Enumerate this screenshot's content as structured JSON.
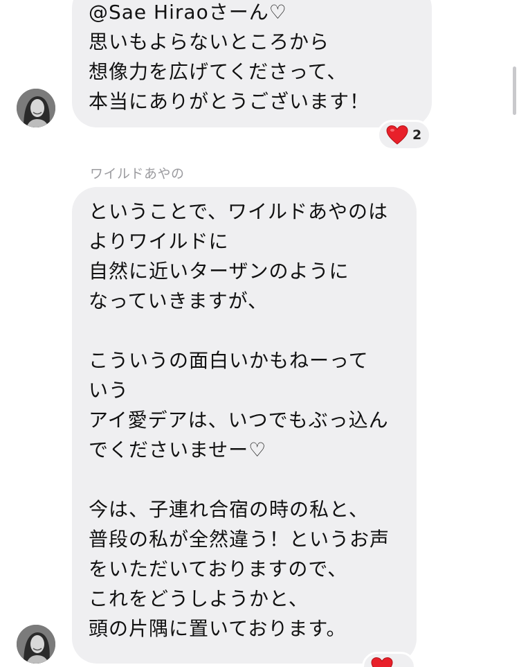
{
  "messages": [
    {
      "lines": [
        "@Sae  Hiraoさーん♡",
        "思いもよらないところから",
        "想像力を広げてくださって、",
        "本当にありがとうございます！"
      ],
      "reaction": {
        "icon": "heart-icon",
        "count": "2"
      }
    },
    {
      "sender": "ワイルドあやの",
      "lines": [
        "ということで、ワイルドあやのは",
        "よりワイルドに",
        "自然に近いターザンのように",
        "なっていきますが、",
        "",
        "こういうの面白いかもねーって",
        "いう",
        "アイ愛デアは、いつでもぶっ込ん",
        "でくださいませー♡",
        "",
        "今は、子連れ合宿の時の私と、",
        "普段の私が全然違う！というお声",
        "をいただいておりますので、",
        "これをどうしようかと、",
        "頭の片隅に置いております。"
      ],
      "reaction": {
        "icon": "heart-icon",
        "count": ""
      }
    }
  ],
  "colors": {
    "bubble": "#efeff1",
    "sender": "#9b9b9f",
    "heart": "#e8202a"
  }
}
